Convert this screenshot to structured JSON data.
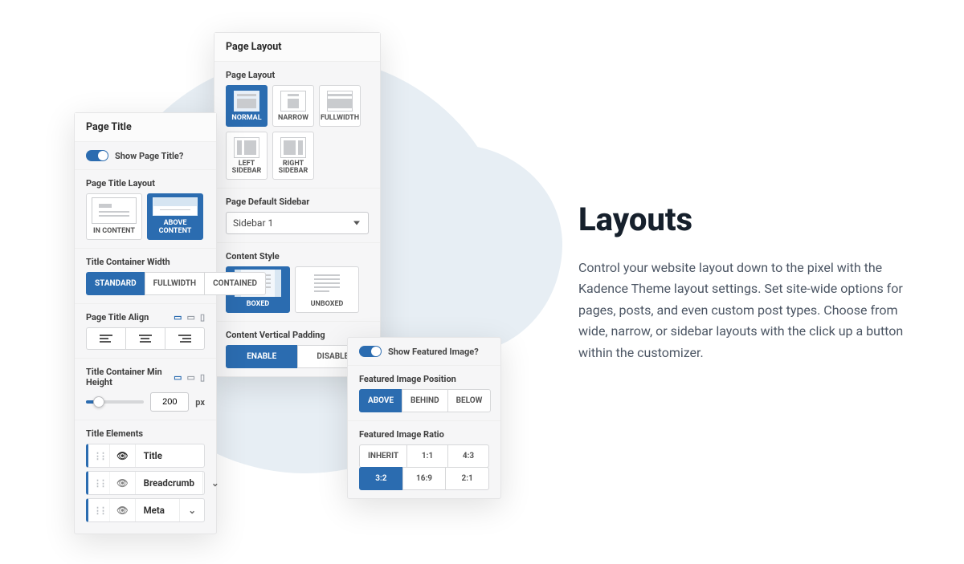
{
  "heading": "Layouts",
  "description": "Control your website layout down to the pixel with the Kadence Theme layout settings. Set site-wide options for pages, posts, and even custom post types. Choose from wide, narrow, or sidebar layouts with the click up a button within the customizer.",
  "page_title_panel": {
    "title": "Page Title",
    "toggle_label": "Show Page Title?",
    "layout_label": "Page Title Layout",
    "layout_options": {
      "in_content": "IN CONTENT",
      "above_content": "ABOVE CONTENT"
    },
    "width_label": "Title Container Width",
    "width_options": {
      "standard": "STANDARD",
      "fullwidth": "FULLWIDTH",
      "contained": "CONTAINED"
    },
    "align_label": "Page Title Align",
    "minheight_label": "Title Container Min Height",
    "minheight_value": "200",
    "minheight_unit": "px",
    "elements_label": "Title Elements",
    "elements": {
      "title": "Title",
      "breadcrumb": "Breadcrumb",
      "meta": "Meta"
    }
  },
  "page_layout_panel": {
    "title": "Page Layout",
    "layout_label": "Page Layout",
    "options": {
      "normal": "NORMAL",
      "narrow": "NARROW",
      "fullwidth": "FULLWIDTH",
      "left_sidebar": "LEFT SIDEBAR",
      "right_sidebar": "RIGHT SIDEBAR"
    },
    "sidebar_label": "Page Default Sidebar",
    "sidebar_value": "Sidebar 1",
    "content_style_label": "Content Style",
    "content_style_options": {
      "boxed": "BOXED",
      "unboxed": "UNBOXED"
    },
    "padding_label": "Content Vertical Padding",
    "padding_options": {
      "enable": "ENABLE",
      "disable": "DISABLE"
    }
  },
  "featured_panel": {
    "toggle_label": "Show Featured Image?",
    "position_label": "Featured Image Position",
    "position_options": {
      "above": "ABOVE",
      "behind": "BEHIND",
      "below": "BELOW"
    },
    "ratio_label": "Featured Image Ratio",
    "ratio_options": {
      "inherit": "INHERIT",
      "r11": "1:1",
      "r43": "4:3",
      "r32": "3:2",
      "r169": "16:9",
      "r21": "2:1"
    }
  }
}
